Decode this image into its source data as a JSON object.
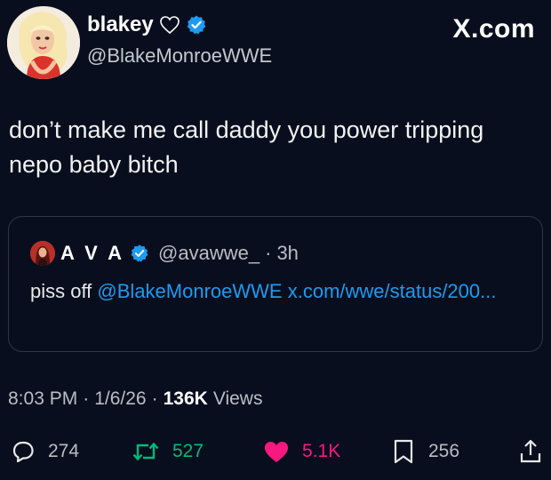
{
  "author": {
    "name": "blakey",
    "handle": "@BlakeMonroeWWE"
  },
  "brand": "X.com",
  "tweet_text": "don’t make me call daddy you power tripping nepo baby bitch",
  "quote": {
    "name": "A V A",
    "handle": "@avawwe_",
    "separator": "·",
    "time": "3h",
    "text_prefix": "piss off ",
    "mention": "@BlakeMonroeWWE",
    "link": "x.com/wwe/status/200..."
  },
  "meta": {
    "time": "8:03 PM",
    "sep1": "·",
    "date": "1/6/26",
    "sep2": "·",
    "views_count": "136K",
    "views_label": "Views"
  },
  "actions": {
    "replies": "274",
    "reposts": "527",
    "likes": "5.1K",
    "bookmarks": "256"
  },
  "colors": {
    "background": "#080e1d",
    "link": "#1d9bf0",
    "repost": "#00ba7c",
    "like": "#f91880",
    "verified": "#1d9bf0"
  },
  "icons": {
    "reply": "speech-bubble-icon",
    "repost": "repost-arrows-icon",
    "like": "heart-filled-icon",
    "bookmark": "bookmark-icon",
    "share": "share-upload-icon"
  }
}
